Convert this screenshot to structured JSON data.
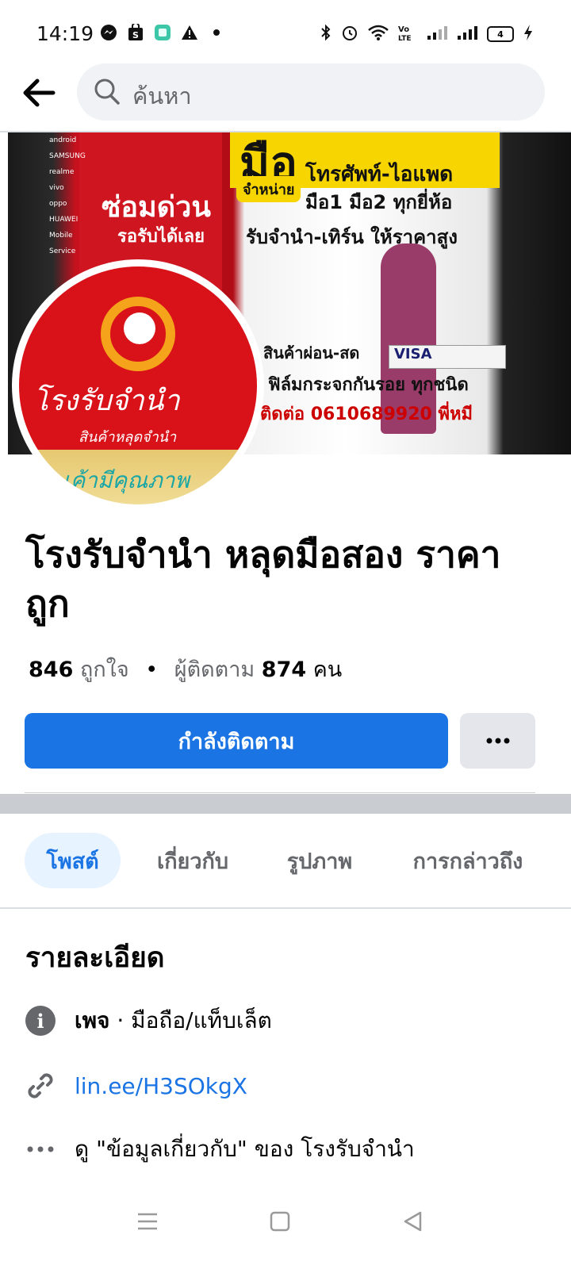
{
  "status_bar": {
    "time": "14:19",
    "left_icons": [
      "messenger-icon",
      "shop-bag-icon",
      "app-square-icon",
      "warning-icon",
      "dot-icon"
    ],
    "right_icons": [
      "bluetooth-icon",
      "alarm-icon",
      "wifi-icon",
      "volte-icon",
      "signal-icon",
      "signal-icon",
      "battery-icon",
      "charging-icon"
    ],
    "volte_label": "Vo\nLTE",
    "battery_level": "4"
  },
  "top_nav": {
    "search_placeholder": "ค้นหา"
  },
  "cover": {
    "sign_top": "มือ",
    "sign_repair": "ซ่อมด่วน",
    "sign_wait": "รอรับได้เลย",
    "sign_sell_badge": "จำหน่าย",
    "sign_phone_tablet": "โทรศัพท์-ไอแพด",
    "sign_hand": "มือ1 มือ2 ทุกยี่ห้อ",
    "sign_pawn": "รับจำนำ-เทิร์น ให้ราคาสูง",
    "sign_installment": "สินค้าผ่อน-สด",
    "sign_visa": "VISA",
    "sign_film": "ฟิล์มกระจกกันรอย ทุกชนิด",
    "sign_contact": "ติดต่อ 0610689920 พี่หมี",
    "brands": [
      "android",
      "SAMSUNG",
      "realme",
      "vivo",
      "oppo",
      "HUAWEI",
      "Mobile Service"
    ]
  },
  "avatar": {
    "line1": "โรงรับจำนำ",
    "line2": "สินค้าหลุดจำนำ",
    "line3": "เค้ามีคุณภาพ"
  },
  "page": {
    "name": "โรงรับจำนำ หลุดมือสอง ราคาถูก",
    "likes_count": "846",
    "likes_label": "ถูกใจ",
    "dot": "•",
    "followers_label": "ผู้ติดตาม",
    "followers_count": "874",
    "followers_unit": "คน",
    "follow_button": "กำลังติดตาม",
    "more_button": "···"
  },
  "tabs": [
    {
      "label": "โพสต์",
      "active": true
    },
    {
      "label": "เกี่ยวกับ",
      "active": false
    },
    {
      "label": "รูปภาพ",
      "active": false
    },
    {
      "label": "การกล่าวถึง",
      "active": false
    }
  ],
  "details": {
    "title": "รายละเอียด",
    "category_bold": "เพจ",
    "category_rest": " · มือถือ/แท็บเล็ต",
    "link": "lin.ee/H3SOkgX",
    "see_about": "ดู \"ข้อมูลเกี่ยวกับ\" ของ โรงรับจำนำ"
  },
  "colors": {
    "accent": "#1b74e4",
    "tab_active_bg": "#e7f3ff",
    "secondary_text": "#65676b",
    "search_bg": "#f0f2f5"
  }
}
